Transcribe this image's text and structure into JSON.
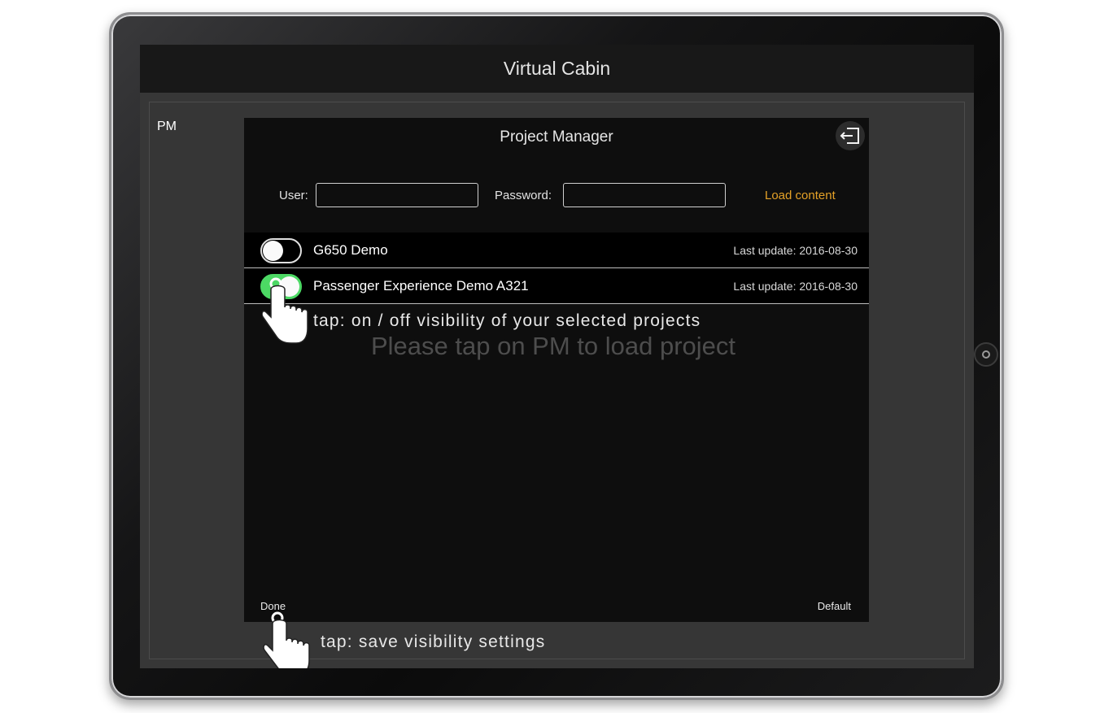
{
  "app": {
    "title": "Virtual Cabin"
  },
  "sidebar": {
    "pm_label": "PM"
  },
  "dialog": {
    "title": "Project Manager",
    "exit_icon": "exit-icon",
    "login": {
      "user_label": "User:",
      "user_value": "",
      "password_label": "Password:",
      "password_value": "",
      "load_label": "Load content",
      "load_color": "#e4a127"
    },
    "projects": [
      {
        "name": "G650 Demo",
        "updated": "Last update: 2016-08-30",
        "visible": false
      },
      {
        "name": "Passenger Experience Demo A321",
        "updated": "Last update: 2016-08-30",
        "visible": true
      }
    ],
    "empty_hint": "Please tap on PM to load project",
    "done_label": "Done",
    "default_label": "Default"
  },
  "annotations": {
    "toggle_hint": "tap: on / off visibility of your selected projects",
    "done_hint": "tap: save visibility settings",
    "hand_icon": "tap-hand-icon"
  },
  "colors": {
    "toggle_on": "#4cd964",
    "accent": "#e4a127"
  }
}
